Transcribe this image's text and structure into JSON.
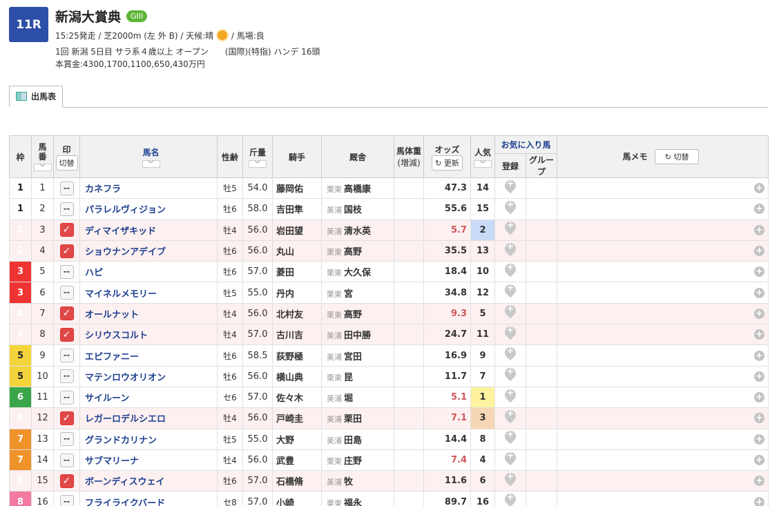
{
  "race": {
    "number": "11R",
    "name": "新潟大賞典",
    "grade": "GIII",
    "line1a": "15:25発走 / 芝2000m (左 外 B) / 天候:晴",
    "line1b": "/ 馬場:良",
    "line2": "1回 新潟 5日目 サラ系４歳以上 オープン　　(国際)(特指) ハンデ 16頭",
    "line3": "本賞金:4300,1700,1100,650,430万円"
  },
  "tab": {
    "label": "出馬表"
  },
  "headers": {
    "waku": "枠",
    "uma": "馬番",
    "mark": "印",
    "mark_toggle": "切替",
    "name": "馬名",
    "sex": "性齢",
    "kin": "斤量",
    "jockey": "騎手",
    "stable": "厩舎",
    "weight1": "馬体重",
    "weight2": "(増減)",
    "odds": "オッズ",
    "update": "更新",
    "pop": "人気",
    "fav": "お気に入り馬",
    "reg": "登録",
    "group": "グループ",
    "memo": "馬メモ",
    "memo_toggle": "切替"
  },
  "horses": [
    {
      "waku": "1",
      "uma": "1",
      "mark": "--",
      "marked": false,
      "name": "カネフラ",
      "sex": "牡5",
      "kin": "54.0",
      "jockey": "藤岡佑",
      "area": "栗東",
      "trainer": "高橋康",
      "odds": "47.3",
      "pop": "14"
    },
    {
      "waku": "1",
      "uma": "2",
      "mark": "--",
      "marked": false,
      "name": "パラレルヴィジョン",
      "sex": "牡6",
      "kin": "58.0",
      "jockey": "吉田隼",
      "area": "美浦",
      "trainer": "国枝",
      "odds": "55.6",
      "pop": "15"
    },
    {
      "waku": "2",
      "uma": "3",
      "mark": "✓",
      "marked": true,
      "name": "ディマイザキッド",
      "sex": "牡4",
      "kin": "56.0",
      "jockey": "岩田望",
      "area": "美浦",
      "trainer": "清水英",
      "odds": "5.7",
      "pop": "2"
    },
    {
      "waku": "2",
      "uma": "4",
      "mark": "✓",
      "marked": true,
      "name": "ショウナンアデイブ",
      "sex": "牡6",
      "kin": "56.0",
      "jockey": "丸山",
      "area": "栗東",
      "trainer": "高野",
      "odds": "35.5",
      "pop": "13"
    },
    {
      "waku": "3",
      "uma": "5",
      "mark": "--",
      "marked": false,
      "name": "ハピ",
      "sex": "牡6",
      "kin": "57.0",
      "jockey": "菱田",
      "area": "栗東",
      "trainer": "大久保",
      "odds": "18.4",
      "pop": "10"
    },
    {
      "waku": "3",
      "uma": "6",
      "mark": "--",
      "marked": false,
      "name": "マイネルメモリー",
      "sex": "牡5",
      "kin": "55.0",
      "jockey": "丹内",
      "area": "栗東",
      "trainer": "宮",
      "odds": "34.8",
      "pop": "12"
    },
    {
      "waku": "4",
      "uma": "7",
      "mark": "✓",
      "marked": true,
      "name": "オールナット",
      "sex": "牡4",
      "kin": "56.0",
      "jockey": "北村友",
      "area": "栗東",
      "trainer": "高野",
      "odds": "9.3",
      "pop": "5"
    },
    {
      "waku": "4",
      "uma": "8",
      "mark": "✓",
      "marked": true,
      "name": "シリウスコルト",
      "sex": "牡4",
      "kin": "57.0",
      "jockey": "古川吉",
      "area": "美浦",
      "trainer": "田中勝",
      "odds": "24.7",
      "pop": "11"
    },
    {
      "waku": "5",
      "uma": "9",
      "mark": "--",
      "marked": false,
      "name": "エピファニー",
      "sex": "牡6",
      "kin": "58.5",
      "jockey": "荻野極",
      "area": "美浦",
      "trainer": "宮田",
      "odds": "16.9",
      "pop": "9"
    },
    {
      "waku": "5",
      "uma": "10",
      "mark": "--",
      "marked": false,
      "name": "マテンロウオリオン",
      "sex": "牡6",
      "kin": "56.0",
      "jockey": "横山典",
      "area": "栗東",
      "trainer": "昆",
      "odds": "11.7",
      "pop": "7"
    },
    {
      "waku": "6",
      "uma": "11",
      "mark": "--",
      "marked": false,
      "name": "サイルーン",
      "sex": "セ6",
      "kin": "57.0",
      "jockey": "佐々木",
      "area": "美浦",
      "trainer": "堀",
      "odds": "5.1",
      "pop": "1"
    },
    {
      "waku": "6",
      "uma": "12",
      "mark": "✓",
      "marked": true,
      "name": "レガーロデルシエロ",
      "sex": "牡4",
      "kin": "56.0",
      "jockey": "戸崎圭",
      "area": "美浦",
      "trainer": "栗田",
      "odds": "7.1",
      "pop": "3"
    },
    {
      "waku": "7",
      "uma": "13",
      "mark": "--",
      "marked": false,
      "name": "グランドカリナン",
      "sex": "牡5",
      "kin": "55.0",
      "jockey": "大野",
      "area": "美浦",
      "trainer": "田島",
      "odds": "14.4",
      "pop": "8"
    },
    {
      "waku": "7",
      "uma": "14",
      "mark": "--",
      "marked": false,
      "name": "サブマリーナ",
      "sex": "牡4",
      "kin": "56.0",
      "jockey": "武豊",
      "area": "栗東",
      "trainer": "庄野",
      "odds": "7.4",
      "pop": "4"
    },
    {
      "waku": "8",
      "uma": "15",
      "mark": "✓",
      "marked": true,
      "name": "ボーンディスウェイ",
      "sex": "牡6",
      "kin": "57.0",
      "jockey": "石橋脩",
      "area": "美浦",
      "trainer": "牧",
      "odds": "11.6",
      "pop": "6"
    },
    {
      "waku": "8",
      "uma": "16",
      "mark": "--",
      "marked": false,
      "name": "フライライクバード",
      "sex": "セ8",
      "kin": "57.0",
      "jockey": "小崎",
      "area": "栗東",
      "trainer": "福永",
      "odds": "89.7",
      "pop": "16"
    }
  ]
}
